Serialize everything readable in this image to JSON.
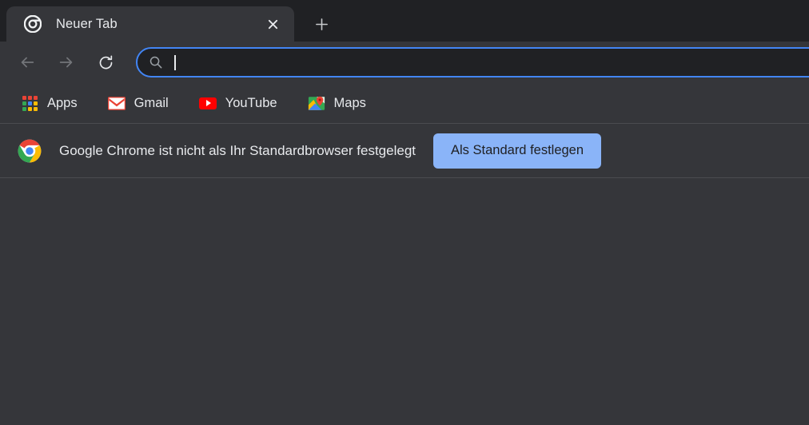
{
  "window": {
    "colors": {
      "tabstrip_bg": "#202124",
      "active_tab_bg": "#35363A",
      "toolbar_bg": "#35363A",
      "content_bg": "#35363A",
      "omnibox_bg": "#202124",
      "omnibox_focus_ring": "#4285F4",
      "text_primary": "#E8EAED",
      "separator": "#4A4C50",
      "accent_button_bg": "#8AB4F8",
      "accent_button_text": "#202124"
    }
  },
  "tab_strip": {
    "tabs": [
      {
        "title": "Neuer Tab",
        "favicon": "chrome-logo-mono-icon",
        "active": true,
        "close_icon": "close-icon"
      }
    ],
    "new_tab_button": {
      "icon": "plus-icon",
      "tooltip": "Neuer Tab"
    }
  },
  "toolbar": {
    "back": {
      "icon": "arrow-left-icon",
      "enabled": false
    },
    "forward": {
      "icon": "arrow-right-icon",
      "enabled": false
    },
    "reload": {
      "icon": "reload-icon",
      "enabled": true
    },
    "omnibox": {
      "icon": "search-icon",
      "value": "",
      "placeholder": "",
      "focused": true,
      "caret_visible": true
    }
  },
  "bookmarks_bar": {
    "items": [
      {
        "label": "Apps",
        "icon": "apps-grid-icon"
      },
      {
        "label": "Gmail",
        "icon": "gmail-icon"
      },
      {
        "label": "YouTube",
        "icon": "youtube-icon"
      },
      {
        "label": "Maps",
        "icon": "google-maps-icon"
      }
    ],
    "apps_grid_colors": [
      "#EA4335",
      "#EA4335",
      "#EA4335",
      "#34A853",
      "#4285F4",
      "#FBBC05",
      "#34A853",
      "#FBBC05",
      "#FBBC05"
    ]
  },
  "infobar": {
    "icon": "chrome-logo-color-icon",
    "message": "Google Chrome ist nicht als Ihr Standardbrowser festgelegt",
    "primary_button_label": "Als Standard festlegen"
  },
  "content": {
    "body": ""
  }
}
